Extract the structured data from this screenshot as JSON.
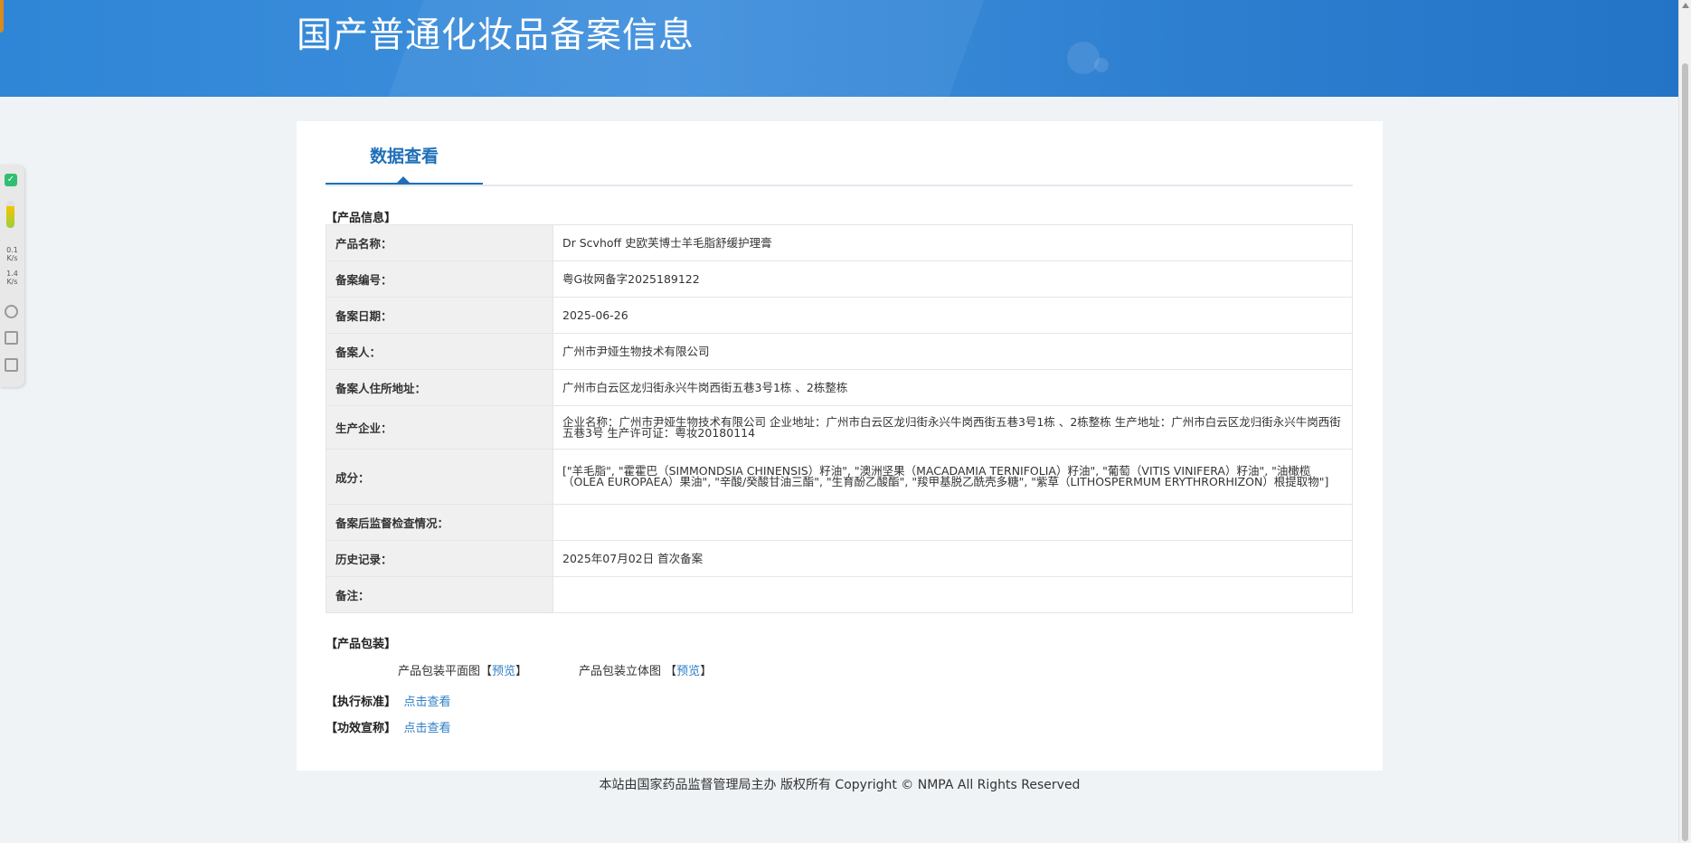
{
  "header": {
    "title": "国产普通化妆品备案信息"
  },
  "tabs": [
    {
      "label": "数据查看"
    }
  ],
  "sections": {
    "product_info": "【产品信息】",
    "packaging": "【产品包装】",
    "standard": "【执行标准】",
    "efficacy": "【功效宣称】"
  },
  "table": {
    "rows": [
      {
        "label": "产品名称：",
        "value": "Dr Scvhoff 史欧芙博士羊毛脂舒缓护理膏"
      },
      {
        "label": "备案编号：",
        "value": "粤G妆网备字2025189122"
      },
      {
        "label": "备案日期：",
        "value": "2025-06-26"
      },
      {
        "label": "备案人：",
        "value": "广州市尹娅生物技术有限公司"
      },
      {
        "label": "备案人住所地址：",
        "value": "广州市白云区龙归街永兴牛岗西街五巷3号1栋 、2栋整栋"
      },
      {
        "label": "生产企业：",
        "value": "企业名称：广州市尹娅生物技术有限公司 企业地址：广州市白云区龙归街永兴牛岗西街五巷3号1栋 、2栋整栋 生产地址：广州市白云区龙归街永兴牛岗西街五巷3号 生产许可证：粤妆20180114"
      },
      {
        "label": "成分：",
        "value": "[\"羊毛脂\", \"霍霍巴（SIMMONDSIA CHINENSIS）籽油\", \"澳洲坚果（MACADAMIA TERNIFOLIA）籽油\", \"葡萄（VITIS VINIFERA）籽油\", \"油橄榄（OLEA EUROPAEA）果油\", \"辛酸/癸酸甘油三酯\", \"生育酚乙酸酯\", \"羧甲基脱乙酰壳多糖\", \"紫草（LITHOSPERMUM ERYTHRORHIZON）根提取物\"]"
      },
      {
        "label": "备案后监督检查情况：",
        "value": ""
      },
      {
        "label": "历史记录：",
        "value": "2025年07月02日 首次备案"
      },
      {
        "label": "备注：",
        "value": ""
      }
    ]
  },
  "packaging": {
    "flat_label": "产品包装平面图",
    "solid_label": "产品包装立体图",
    "preview": "预览",
    "bracket_open": "【",
    "bracket_close": "】"
  },
  "links": {
    "view": "点击查看"
  },
  "side_widget": {
    "net_up": "0.1",
    "net_down": "1.4",
    "unit": "K/s"
  },
  "footer": {
    "text": "本站由国家药品监督管理局主办 版权所有 Copyright © NMPA All Rights Reserved"
  }
}
